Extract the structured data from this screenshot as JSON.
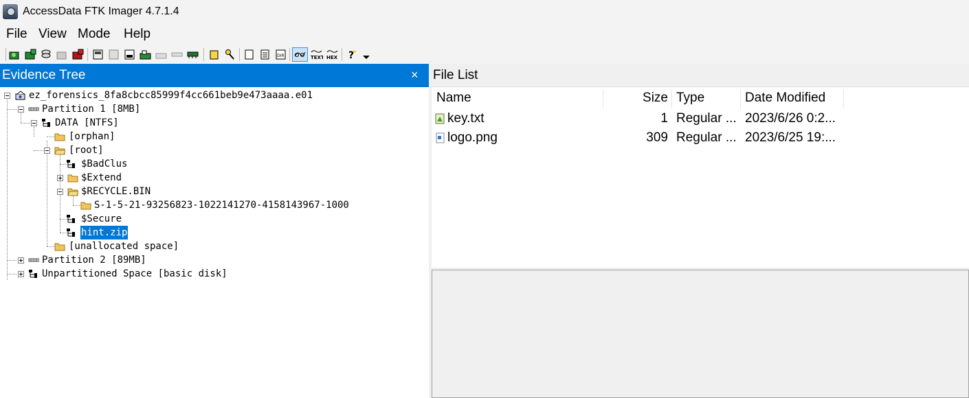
{
  "window": {
    "title": "AccessData FTK Imager 4.7.1.4"
  },
  "menu": [
    "File",
    "View",
    "Mode",
    "Help"
  ],
  "toolbar": {
    "icons": [
      "add-evidence-icon",
      "add-all-evidence-icon",
      "image-mounting-icon",
      "remove-evidence-icon",
      "remove-all-evidence-icon",
      "create-disk-image-icon",
      "export-disk-image-icon",
      "capture-memory-icon",
      "obtain-protected-files-icon",
      "detect-encryption-icon",
      "ram-icon",
      "verify-drive-icon",
      "export-hash-icon",
      "new-page-icon",
      "properties-icon",
      "dir-listing-icon",
      "auto-viewer-icon",
      "text-viewer-icon",
      "hex-viewer-icon",
      "help-icon"
    ],
    "text_label": "TEXT",
    "hex_label": "HEX",
    "dir_label": "DIR"
  },
  "evidence_tree": {
    "title": "Evidence Tree",
    "close_glyph": "×",
    "nodes": [
      "ez_forensics_8fa8cbcc85999f4cc661beb9e473aaaa.e01",
      "Partition 1 [8MB]",
      "DATA [NTFS]",
      "[orphan]",
      "[root]",
      "$BadClus",
      "$Extend",
      "$RECYCLE.BIN",
      "S-1-5-21-93256823-1022141270-4158143967-1000",
      "$Secure",
      "hint.zip",
      "[unallocated space]",
      "Partition 2 [89MB]",
      "Unpartitioned Space [basic disk]"
    ]
  },
  "file_list": {
    "title": "File List",
    "columns": [
      "Name",
      "Size",
      "Type",
      "Date Modified"
    ],
    "rows": [
      {
        "name": "key.txt",
        "size": "1",
        "type": "Regular ...",
        "date": "2023/6/26 0:2..."
      },
      {
        "name": "logo.png",
        "size": "309",
        "type": "Regular ...",
        "date": "2023/6/25 19:..."
      }
    ]
  },
  "colors": {
    "accent": "#0078d7",
    "folder": "#f2c55c"
  }
}
